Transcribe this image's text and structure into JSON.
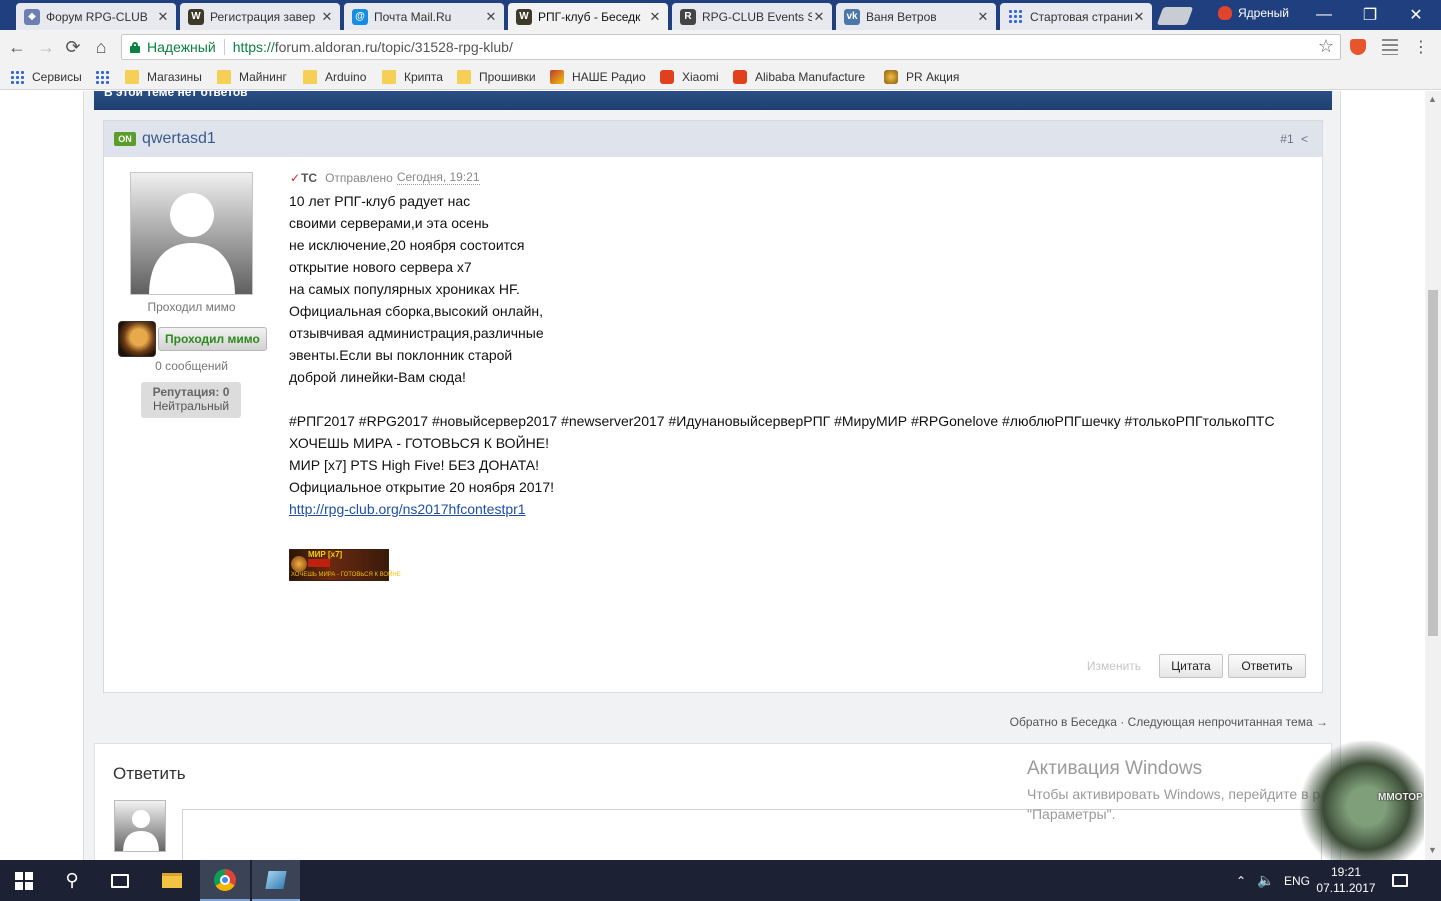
{
  "browser": {
    "tabs": [
      {
        "title": "Форум RPG-CLUB",
        "icon": "forum-favicon",
        "color": "#6b7fb0"
      },
      {
        "title": "Регистрация завер",
        "icon": "wow-favicon",
        "color": "#3e3a2a"
      },
      {
        "title": "Почта Mail.Ru",
        "icon": "mailru-favicon",
        "color": "#168de2"
      },
      {
        "title": "РПГ-клуб - Беседк",
        "icon": "wow-favicon",
        "color": "#3e3a2a"
      },
      {
        "title": "RPG-CLUB Events S",
        "icon": "rpgclub-favicon",
        "color": "#444"
      },
      {
        "title": "Ваня Ветров",
        "icon": "vk-favicon",
        "color": "#4a76a8"
      },
      {
        "title": "Стартовая страниц",
        "icon": "apps-grid-favicon",
        "color": "#3367d6"
      }
    ],
    "profile_name": "Ядреный",
    "secure_label": "Надежный",
    "url_protocol": "https://",
    "url_rest": "forum.aldoran.ru/topic/31528-rpg-klub/",
    "bookmarks": [
      {
        "label": "Сервисы",
        "icon": "apps-grid-icon"
      },
      {
        "label": "Магазины",
        "icon": "folder-icon"
      },
      {
        "label": "Майнинг",
        "icon": "folder-icon"
      },
      {
        "label": "Arduino",
        "icon": "folder-icon"
      },
      {
        "label": "Крипта",
        "icon": "folder-icon"
      },
      {
        "label": "Прошивки",
        "icon": "folder-icon"
      },
      {
        "label": "НАШЕ Радио",
        "icon": "nashe-radio-icon"
      },
      {
        "label": "Xiaomi",
        "icon": "xiaomi-icon"
      },
      {
        "label": "Alibaba Manufacture",
        "icon": "alibaba-icon"
      },
      {
        "label": "PR Акция",
        "icon": "pr-icon"
      }
    ]
  },
  "thread": {
    "header_text": "В этой теме нет ответов",
    "post": {
      "online_badge": "ON",
      "author": "qwertasd1",
      "post_number": "#1",
      "user_title": "Проходил мимо",
      "rank_label": "Проходил мимо",
      "post_count": "0 сообщений",
      "reputation_label": "Репутация: 0",
      "reputation_level": "Нейтральный",
      "tc_label": "ТС",
      "sent_label": "Отправлено",
      "sent_time": "Сегодня, 19:21",
      "lines": [
        "10 лет РПГ-клуб радует нас",
        "своими серверами,и эта осень",
        "не исключение,20 ноября состоится",
        "открытие нового сервера х7",
        "на самых популярных хрониках HF.",
        "Официальная сборка,высокий онлайн,",
        "отзывчивая администрация,различные",
        "эвенты.Если вы поклонник старой",
        "доброй линейки-Вам сюда!",
        "",
        "#РПГ2017 #RPG2017 #новыйсервер2017 #newserver2017 #ИдунановыйсерверРПГ #МируМИР #RPGonelove #люблюРПГшечку #толькоРПГтолькоПТС",
        "ХОЧЕШЬ МИРА - ГОТОВЬСЯ К ВОЙНЕ!",
        "МИР [x7] PTS High Five! БЕЗ ДОНАТА!",
        "Официальное открытие 20 ноября 2017!"
      ],
      "link": "http://rpg-club.org/ns2017hfcontestpr1",
      "banner": {
        "title": "МИР [x7]",
        "tag": "БЕЗ ДОНАТА",
        "slogan": "ХОЧЕШЬ МИРА - ГОТОВЬСЯ К ВОЙНЕ"
      },
      "buttons": {
        "edit": "Изменить",
        "quote": "Цитата",
        "reply": "Ответить"
      }
    },
    "nav": {
      "back": "Обратно в Беседка",
      "sep": "·",
      "next": "Следующая непрочитанная тема",
      "arrow": "→"
    },
    "reply_title": "Ответить"
  },
  "windows_activation": {
    "title": "Активация Windows",
    "line1": "Чтобы активировать Windows, перейдите в разд",
    "line2": "\"Параметры\"."
  },
  "overlay_logo": "ММОТОР",
  "taskbar": {
    "language": "ENG",
    "time": "19:21",
    "date": "07.11.2017"
  }
}
